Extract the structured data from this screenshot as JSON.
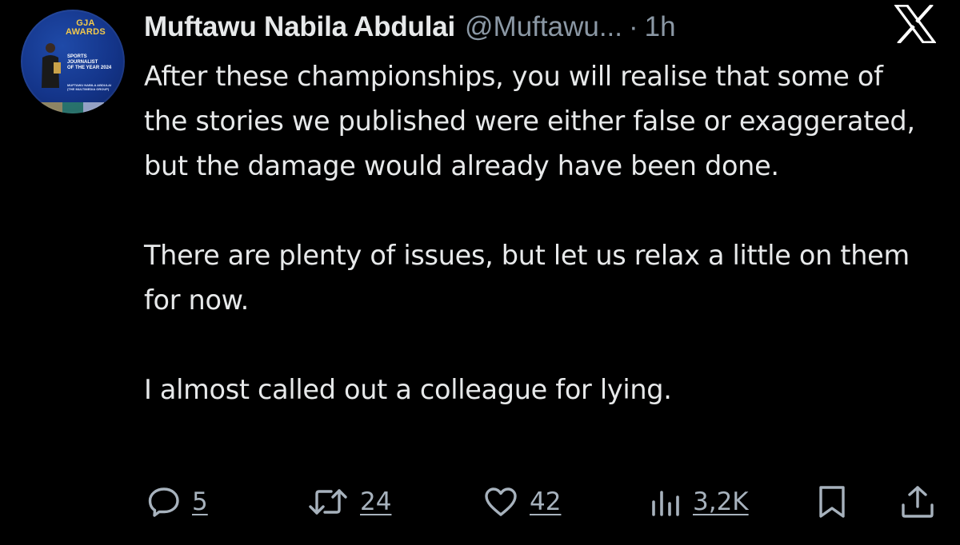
{
  "author": {
    "display_name": "Muftawu Nabila Abdulai",
    "handle": "@Muftawu...",
    "separator": "·",
    "time": "1h",
    "avatar": {
      "badge_title_line1": "GJA",
      "badge_title_line2": "AWARDS",
      "award_line1": "SPORTS",
      "award_line2": "JOURNALIST",
      "award_line3": "OF THE YEAR 2024",
      "award_name_line1": "MUFTAWU NABILA ABDULAI",
      "award_name_line2": "(THE MULTIMEDIA GROUP)"
    }
  },
  "platform_icon": "x-logo-icon",
  "tweet": {
    "paragraphs": [
      "After these championships, you will realise that some of the stories we published were either false or exaggerated, but the damage would already have been done.",
      "There are plenty of issues, but let us relax a little on them for now.",
      "I almost called out a colleague for lying."
    ]
  },
  "actions": {
    "replies": {
      "icon": "reply-icon",
      "count": "5"
    },
    "reposts": {
      "icon": "repost-icon",
      "count": "24"
    },
    "likes": {
      "icon": "heart-icon",
      "count": "42"
    },
    "views": {
      "icon": "views-icon",
      "count": "3,2K"
    },
    "bookmark": {
      "icon": "bookmark-icon"
    },
    "share": {
      "icon": "share-icon"
    }
  },
  "colors": {
    "background": "#000000",
    "text": "#e7e9ea",
    "muted": "#8b98a5",
    "action": "#a7b2bd",
    "badge_gold": "#f2c94c",
    "avatar_blue": "#14358a"
  }
}
